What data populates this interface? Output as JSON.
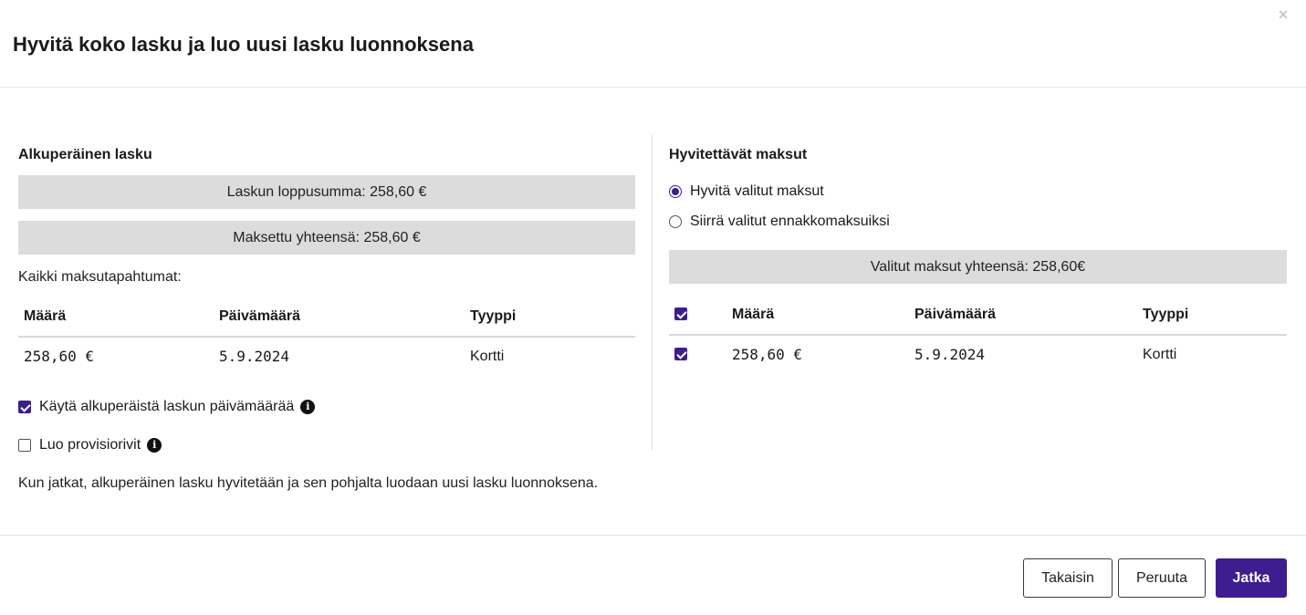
{
  "dialog": {
    "title": "Hyvitä koko lasku ja luo uusi lasku luonnoksena",
    "close_label": "×"
  },
  "original": {
    "title": "Alkuperäinen lasku",
    "total_label": "Laskun loppusumma: 258,60 €",
    "paid_label": "Maksettu yhteensä: 258,60 €",
    "transactions_label": "Kaikki maksutapahtumat:",
    "columns": [
      "Määrä",
      "Päivämäärä",
      "Tyyppi"
    ],
    "rows": [
      {
        "amount": "258,60 €",
        "date": "5.9.2024",
        "type": "Kortti"
      }
    ],
    "use_original_date": {
      "label": "Käytä alkuperäistä laskun päivämäärää",
      "checked": true
    },
    "create_provision": {
      "label": "Luo provisiorivit",
      "checked": false
    },
    "note": "Kun jatkat, alkuperäinen lasku hyvitetään ja sen pohjalta luodaan uusi lasku luonnoksena."
  },
  "refund": {
    "title": "Hyvitettävät maksut",
    "options": [
      {
        "label": "Hyvitä valitut maksut",
        "selected": true
      },
      {
        "label": "Siirrä valitut ennakkomaksuiksi",
        "selected": false
      }
    ],
    "selected_total_label": "Valitut maksut yhteensä: 258,60€",
    "columns": [
      "Määrä",
      "Päivämäärä",
      "Tyyppi"
    ],
    "rows": [
      {
        "amount": "258,60 €",
        "date": "5.9.2024",
        "type": "Kortti",
        "checked": true
      }
    ]
  },
  "footer": {
    "back_label": "Takaisin",
    "cancel_label": "Peruuta",
    "continue_label": "Jatka"
  },
  "colors": {
    "accent": "#3d1d8f",
    "summary_bg": "#dcdcdc"
  }
}
